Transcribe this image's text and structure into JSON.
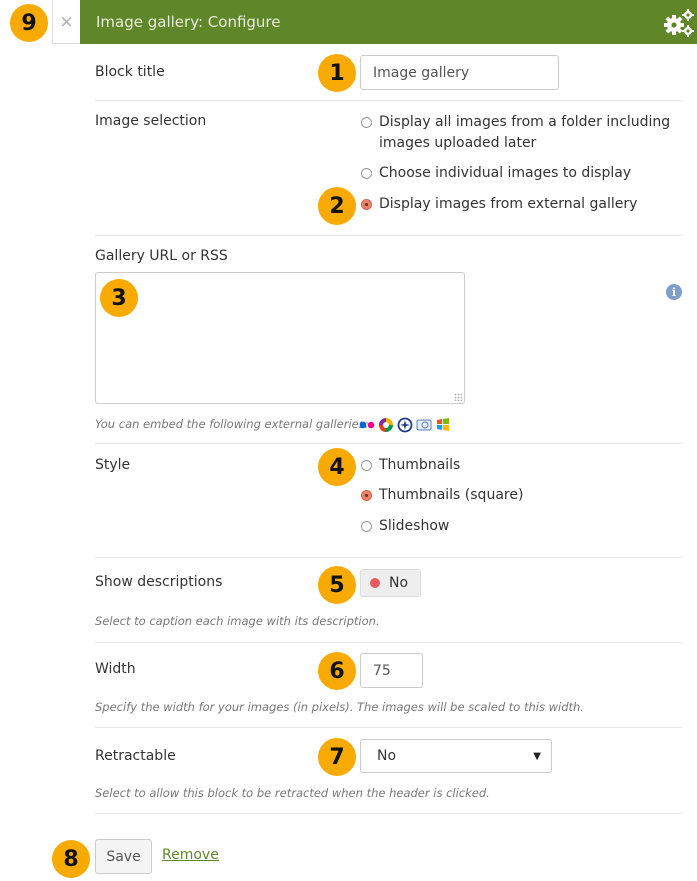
{
  "header": {
    "close_icon": "×",
    "title": "Image gallery: Configure",
    "accent_color": "#5f872a",
    "settings_icon": "gears-icon"
  },
  "callouts": [
    "1",
    "2",
    "3",
    "4",
    "5",
    "6",
    "7",
    "8",
    "9"
  ],
  "block_title": {
    "label": "Block title",
    "value": "Image gallery"
  },
  "image_selection": {
    "label": "Image selection",
    "options": [
      {
        "label": "Display all images from a folder including images uploaded later",
        "checked": false
      },
      {
        "label": "Choose individual images to display",
        "checked": false
      },
      {
        "label": "Display images from external gallery",
        "checked": true
      }
    ]
  },
  "gallery_url": {
    "label": "Gallery URL or RSS",
    "value": "",
    "info_icon": "i",
    "hint": "You can embed the following external galleries:",
    "gallery_icons": [
      "flickr-icon",
      "picasa-icon",
      "panoramio-icon",
      "photobucket-icon",
      "windows-live-icon"
    ]
  },
  "style": {
    "label": "Style",
    "options": [
      {
        "label": "Thumbnails",
        "checked": false
      },
      {
        "label": "Thumbnails (square)",
        "checked": true
      },
      {
        "label": "Slideshow",
        "checked": false
      }
    ]
  },
  "show_descriptions": {
    "label": "Show descriptions",
    "toggle_label": "No",
    "hint": "Select to caption each image with its description."
  },
  "width": {
    "label": "Width",
    "value": "75",
    "hint": "Specify the width for your images (in pixels). The images will be scaled to this width."
  },
  "retractable": {
    "label": "Retractable",
    "selected": "No",
    "caret": "▼",
    "hint": "Select to allow this block to be retracted when the header is clicked."
  },
  "actions": {
    "save_label": "Save",
    "remove_label": "Remove"
  }
}
